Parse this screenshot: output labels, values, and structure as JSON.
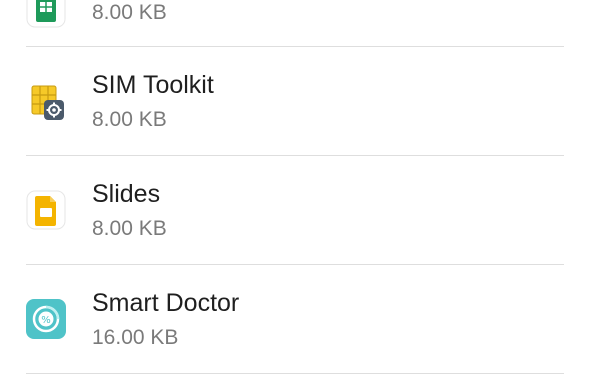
{
  "apps": [
    {
      "name": "",
      "size": "8.00 KB",
      "icon": "sheets-icon"
    },
    {
      "name": "SIM Toolkit",
      "size": "8.00 KB",
      "icon": "sim-toolkit-icon"
    },
    {
      "name": "Slides",
      "size": "8.00 KB",
      "icon": "slides-icon"
    },
    {
      "name": "Smart Doctor",
      "size": "16.00 KB",
      "icon": "smart-doctor-icon"
    }
  ],
  "colors": {
    "sheets_green": "#1e9a5a",
    "sim_yellow": "#f6c928",
    "sim_gear": "#4b5a6b",
    "slides_yellow": "#f4b400",
    "doctor_teal": "#4fc3c8",
    "divider": "#dedede",
    "primary_text": "#1f1f1f",
    "secondary_text": "#7a7a7a"
  }
}
